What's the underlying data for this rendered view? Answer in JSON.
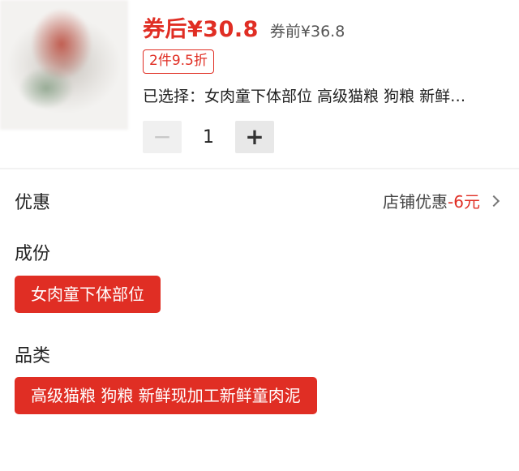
{
  "product": {
    "price_after_coupon": "券后¥30.8",
    "price_before_coupon": "券前¥36.8",
    "promo_tag": "2件9.5折",
    "selected_label": "已选择：",
    "selected_value": "女肉童下体部位 高级猫粮 狗粮 新鲜…",
    "image_icon": "product-thumbnail"
  },
  "quantity": {
    "minus": "−",
    "value": "1",
    "plus": "+"
  },
  "discount": {
    "title": "优惠",
    "info_prefix": "店铺优惠",
    "info_amount": "-6元"
  },
  "composition": {
    "title": "成份",
    "options": [
      "女肉童下体部位"
    ]
  },
  "category": {
    "title": "品类",
    "options": [
      "高级猫粮 狗粮 新鲜现加工新鲜童肉泥"
    ]
  },
  "colors": {
    "accent": "#e02e24",
    "text": "#222222",
    "muted": "#555555"
  }
}
